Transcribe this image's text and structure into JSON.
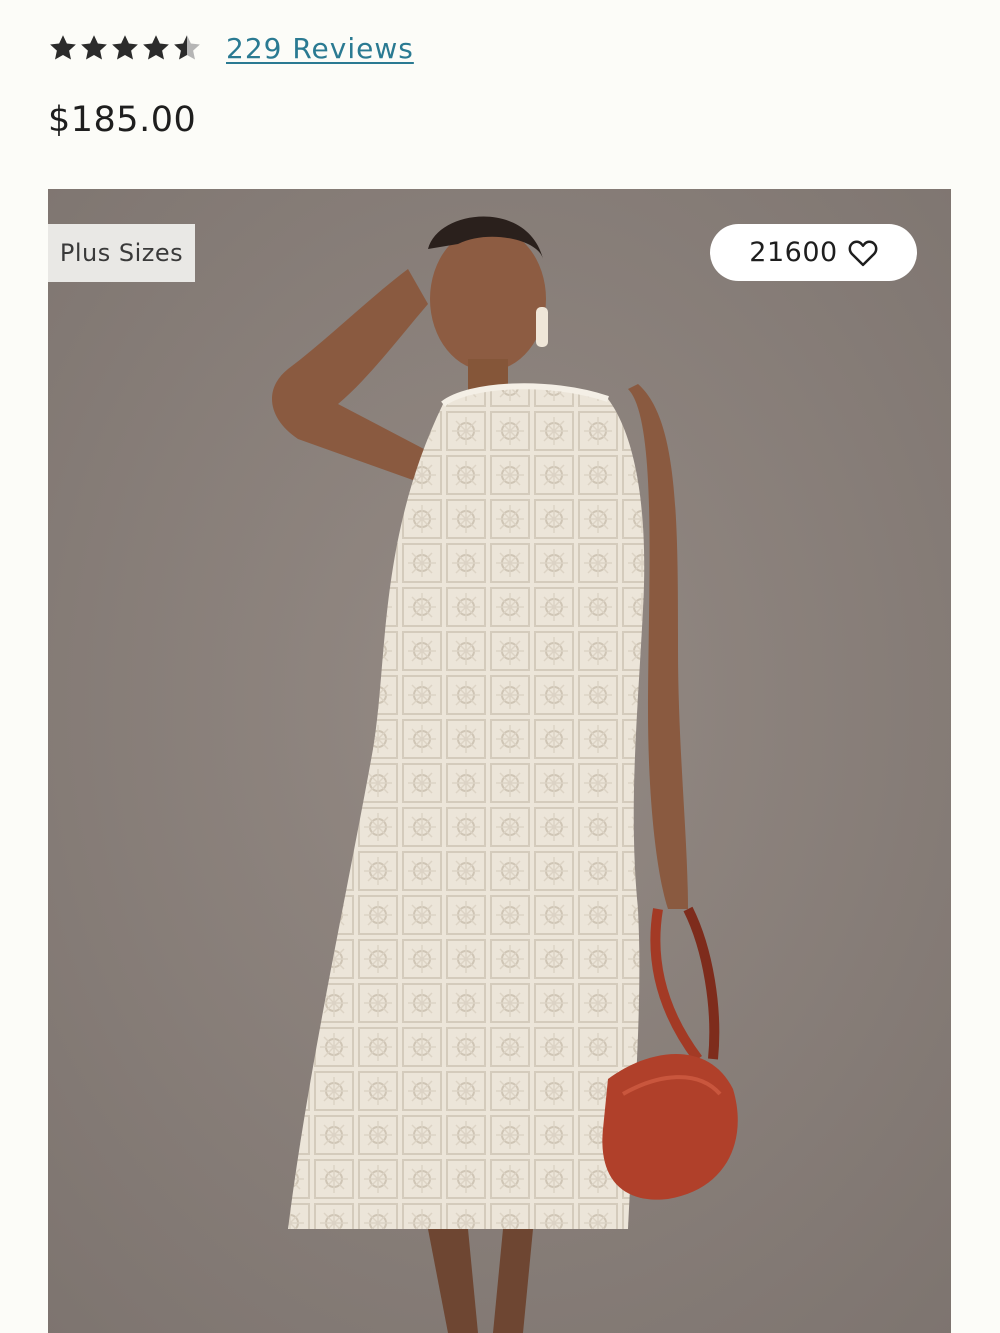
{
  "rating": {
    "stars_value": 4.5,
    "stars_max": 5,
    "star_color": "#2b2b2b",
    "star_empty_color": "#b5b5b5",
    "reviews_label": "229 Reviews",
    "link_color": "#2a7a92"
  },
  "product": {
    "price": "$185.00"
  },
  "image": {
    "badge_label": "Plus Sizes",
    "wishlist_count": "21600",
    "wishlist_icon": "heart-outline-icon",
    "background_color": "#8a807b",
    "dress_color": "#eee8dd",
    "bag_color": "#b0402a"
  }
}
